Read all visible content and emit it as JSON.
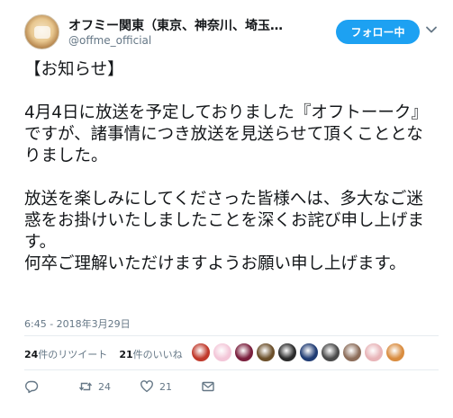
{
  "account": {
    "name": "オフミー関東（東京、神奈川、埼玉…",
    "handle": "@offme_official"
  },
  "follow_button": {
    "label": "フォロー中"
  },
  "icons": {
    "avatar": "profile-avatar",
    "menu": "chevron-down-icon",
    "reply": "reply-icon",
    "retweet": "retweet-icon",
    "like": "heart-icon",
    "dm": "direct-message-icon"
  },
  "tweet": {
    "paragraphs": [
      "【お知らせ】",
      "4月4日に放送を予定しておりました『オフトーーク』ですが、諸事情につき放送を見送らせて頂くこととなりました。",
      "放送を楽しみにしてくださった皆様へは、多大なご迷惑をお掛けいたしましたことを深くお詫び申し上げます。\n何卒ご理解いただけますようお願い申し上げます。"
    ],
    "timestamp": "6:45 - 2018年3月29日"
  },
  "stats": {
    "retweets_count": "24",
    "retweets_label": "件のリツイート",
    "likes_count": "21",
    "likes_label": "件のいいね"
  },
  "liker_colors": [
    "#c0392b",
    "#f3c6d8",
    "#7a1f3d",
    "#6b4f2a",
    "#2b2b2b",
    "#1f3b73",
    "#4a4a4a",
    "#8c6d5a",
    "#e8b4b8",
    "#d98c3f"
  ],
  "actions": {
    "retweet_count": "24",
    "like_count": "21"
  }
}
